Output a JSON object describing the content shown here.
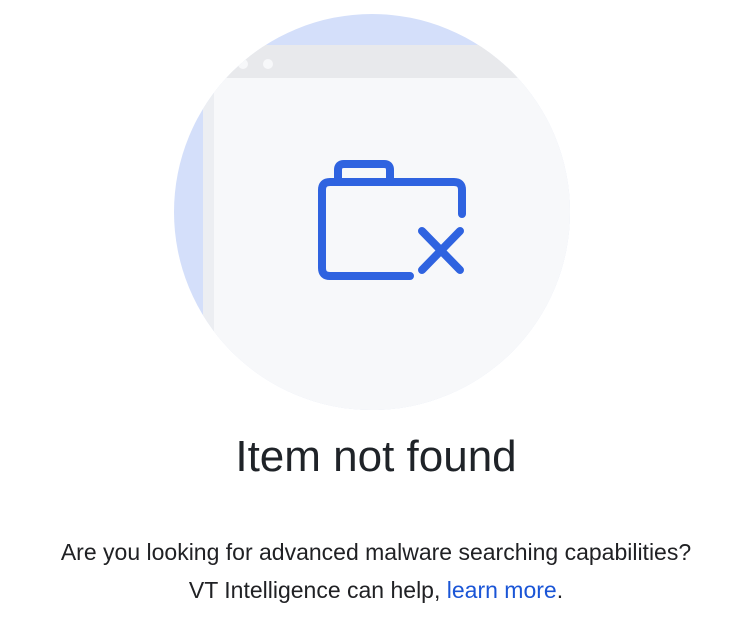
{
  "empty_state": {
    "illustration_icon": "folder-x-icon",
    "title": "Item not found",
    "message_line1": "Are you looking for advanced malware searching capabilities?",
    "message_line2_prefix": "VT Intelligence can help, ",
    "learn_more_link": "learn more",
    "message_line2_suffix": "."
  },
  "colors": {
    "accent": "#2f63e0",
    "circle": "#d4dffa",
    "window": "#f7f8fa",
    "window_bar": "#e8e9ec",
    "link": "#1a55d6"
  }
}
